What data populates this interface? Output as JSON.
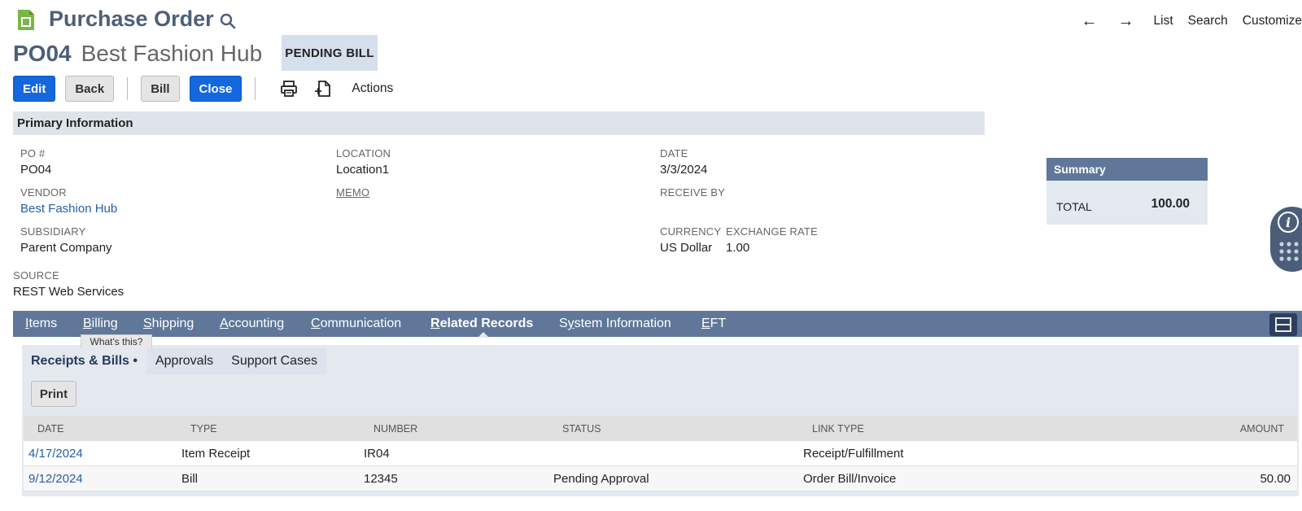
{
  "header": {
    "title": "Purchase Order",
    "nav": {
      "back_arrow": "←",
      "forward_arrow": "→",
      "list": "List",
      "search": "Search",
      "customize": "Customize"
    }
  },
  "record": {
    "id": "PO04",
    "name": "Best Fashion Hub",
    "status": "PENDING BILL"
  },
  "toolbar": {
    "edit": "Edit",
    "back": "Back",
    "bill": "Bill",
    "close": "Close",
    "actions": "Actions"
  },
  "primary": {
    "section_title": "Primary Information",
    "po_label": "PO #",
    "po_value": "PO04",
    "vendor_label": "VENDOR",
    "vendor_value": "Best Fashion Hub",
    "subsidiary_label": "SUBSIDIARY",
    "subsidiary_value": "Parent Company",
    "source_label": "SOURCE",
    "source_value": "REST Web Services",
    "location_label": "LOCATION",
    "location_value": "Location1",
    "memo_label": "MEMO",
    "date_label": "DATE",
    "date_value": "3/3/2024",
    "receive_by_label": "RECEIVE BY",
    "currency_label": "CURRENCY",
    "currency_value": "US Dollar",
    "exchange_rate_label": "EXCHANGE RATE",
    "exchange_rate_value": "1.00"
  },
  "summary": {
    "title": "Summary",
    "total_label": "TOTAL",
    "total_value": "100.00"
  },
  "tabs": [
    {
      "label": "Items",
      "key_letter": "I",
      "rest": "tems"
    },
    {
      "label": "Billing",
      "key_letter": "B",
      "rest": "illing"
    },
    {
      "label": "Shipping",
      "key_letter": "S",
      "rest": "hipping"
    },
    {
      "label": "Accounting",
      "key_letter": "A",
      "rest": "ccounting"
    },
    {
      "label": "Communication",
      "key_letter": "C",
      "rest": "ommunication"
    },
    {
      "label": "Related Records",
      "key_letter": "R",
      "rest": "elated Records"
    },
    {
      "label": "System Information",
      "key_letter": "y",
      "rest_before": "S",
      "rest": "stem Information"
    },
    {
      "label": "EFT",
      "key_letter": "E",
      "rest": "FT"
    }
  ],
  "tooltip": "What's this?",
  "subtabs": {
    "receipts": "Receipts & Bills •",
    "approvals": "Approvals",
    "support": "Support Cases"
  },
  "print_label": "Print",
  "table": {
    "headers": [
      "DATE",
      "TYPE",
      "NUMBER",
      "STATUS",
      "LINK TYPE",
      "AMOUNT"
    ],
    "rows": [
      {
        "date": "4/17/2024",
        "type": "Item Receipt",
        "number": "IR04",
        "status": "",
        "link_type": "Receipt/Fulfillment",
        "amount": ""
      },
      {
        "date": "9/12/2024",
        "type": "Bill",
        "number": "12345",
        "status": "Pending Approval",
        "link_type": "Order Bill/Invoice",
        "amount": "50.00"
      }
    ]
  },
  "colors": {
    "accent_blue": "#1467dc",
    "tab_bar": "#607799",
    "title_slate": "#4d5f79",
    "link": "#255ea8"
  }
}
